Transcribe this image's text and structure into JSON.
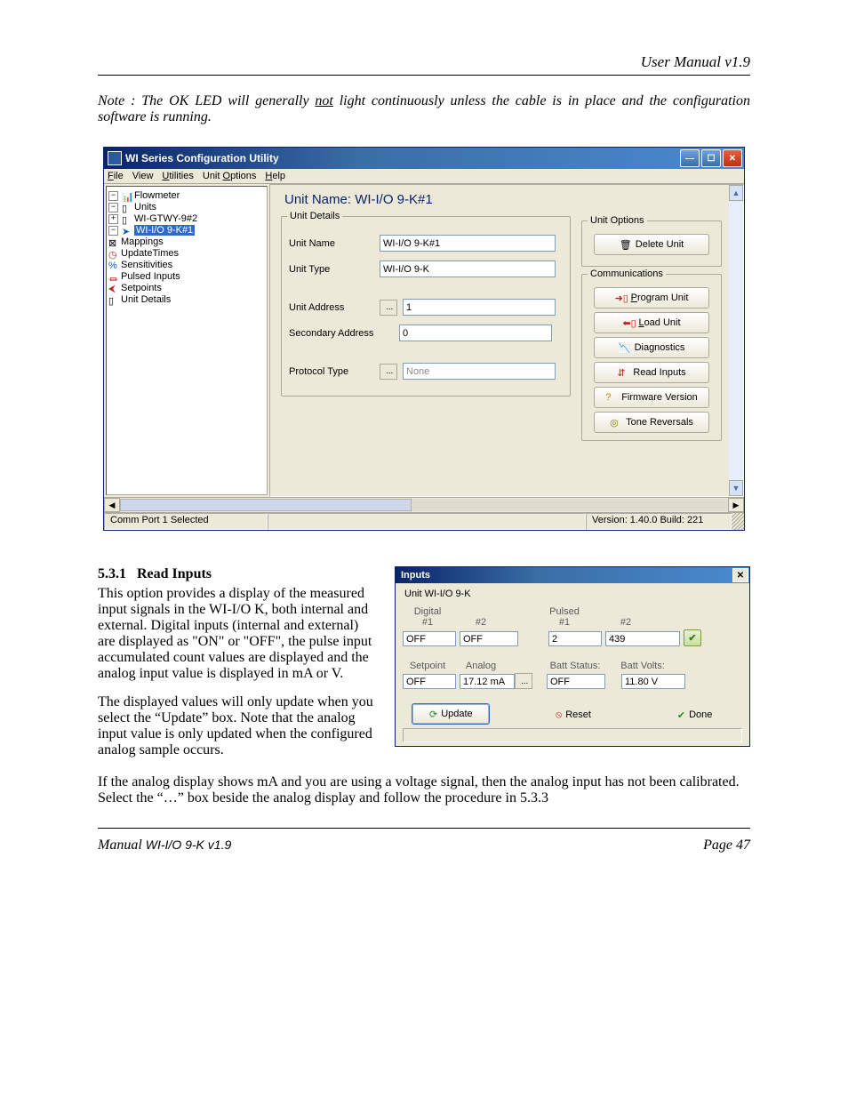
{
  "page": {
    "header_right": "User Manual v1.9",
    "note_prefix": "Note : The OK LED will generally ",
    "note_not": "not",
    "note_suffix": " light continuously unless the cable is in place and the configuration software is running.",
    "footer_left_a": "Manual ",
    "footer_left_b": "WI-I/O 9-K v1.9",
    "footer_right": "Page 47"
  },
  "win": {
    "title": "WI Series Configuration Utility",
    "menu": {
      "file": "File",
      "view": "View",
      "utilities": "Utilities",
      "unitoptions": "Unit Options",
      "help": "Help"
    },
    "tree": {
      "root": "Flowmeter",
      "units": "Units",
      "gtwy": "WI-GTWY-9#2",
      "sel": "WI-I/O 9-K#1",
      "mappings": "Mappings",
      "updatetimes": "UpdateTimes",
      "sensitivities": "Sensitivities",
      "pulsed": "Pulsed Inputs",
      "setpoints": "Setpoints",
      "unitdetails": "Unit Details"
    },
    "heading": "Unit Name: WI-I/O 9-K#1",
    "details": {
      "legend": "Unit Details",
      "unitname_lbl": "Unit Name",
      "unitname_val": "WI-I/O 9-K#1",
      "unittype_lbl": "Unit Type",
      "unittype_val": "WI-I/O 9-K",
      "unitaddr_lbl": "Unit Address",
      "unitaddr_val": "1",
      "secaddr_lbl": "Secondary Address",
      "secaddr_val": "0",
      "proto_lbl": "Protocol Type",
      "proto_val": "None",
      "dots": "..."
    },
    "unitoptions": {
      "legend": "Unit Options",
      "delete": "Delete Unit"
    },
    "comms": {
      "legend": "Communications",
      "program": "Program Unit",
      "load": "Load Unit",
      "diag": "Diagnostics",
      "readinputs": "Read Inputs",
      "fw": "Firmware Version",
      "tone": "Tone Reversals"
    },
    "status_left": "Comm Port 1 Selected",
    "status_right": "Version: 1.40.0 Build: 221"
  },
  "section": {
    "num": "5.3.1",
    "title": "Read Inputs",
    "p1": "This option provides a display of the measured input signals in the WI-I/O K, both internal and external.   Digital inputs (internal and external) are displayed as \"ON\" or \"OFF\",  the pulse input accumulated count values are displayed and the analog input value is displayed in mA or V.",
    "p2": "The displayed values will only update when you select the “Update” box.  Note that the analog input value is only updated when the configured analog sample occurs.",
    "p3": "If the analog display shows mA and you are using a voltage signal,  then the analog input has not been calibrated.  Select the “…” box beside the analog display and follow the procedure in 5.3.3"
  },
  "dlg": {
    "title": "Inputs",
    "unit_lbl": "Unit  WI-I/O 9-K",
    "digital_lbl": "Digital",
    "pulsed_lbl": "Pulsed",
    "col1": "#1",
    "col2": "#2",
    "dig1": "OFF",
    "dig2": "OFF",
    "pul1": "2",
    "pul2": "439",
    "setpoint_lbl": "Setpoint",
    "analog_lbl": "Analog",
    "batt_status_lbl": "Batt Status:",
    "batt_volts_lbl": "Batt Volts:",
    "setpoint_val": "OFF",
    "analog_val": "17.12 mA",
    "batt_status_val": "OFF",
    "batt_volts_val": "11.80 V",
    "dots": "...",
    "update": "Update",
    "reset": "Reset",
    "done": "Done"
  },
  "chart_data": {
    "type": "table",
    "title": "Inputs — Unit WI-I/O 9-K",
    "series": [
      {
        "name": "Digital #1",
        "value": "OFF"
      },
      {
        "name": "Digital #2",
        "value": "OFF"
      },
      {
        "name": "Pulsed #1",
        "value": 2
      },
      {
        "name": "Pulsed #2",
        "value": 439
      },
      {
        "name": "Setpoint",
        "value": "OFF"
      },
      {
        "name": "Analog",
        "value": "17.12 mA"
      },
      {
        "name": "Batt Status",
        "value": "OFF"
      },
      {
        "name": "Batt Volts",
        "value": "11.80 V"
      }
    ]
  }
}
